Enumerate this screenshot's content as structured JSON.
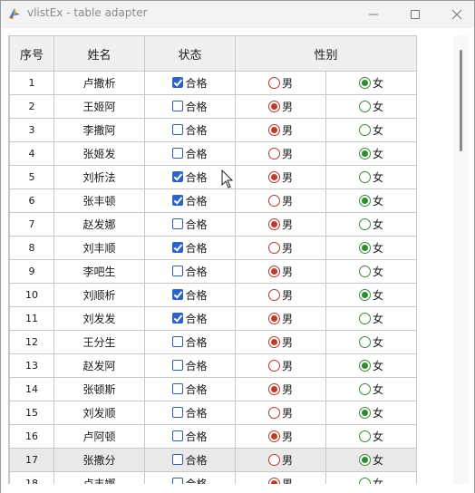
{
  "window": {
    "title": "vlistEx - table adapter"
  },
  "headers": {
    "seq": "序号",
    "name": "姓名",
    "status": "状态",
    "gender": "性别"
  },
  "labels": {
    "pass": "合格",
    "male": "男",
    "female": "女"
  },
  "rows": [
    {
      "seq": "1",
      "name": "卢撒析",
      "pass": true,
      "gender": "female"
    },
    {
      "seq": "2",
      "name": "王姬阿",
      "pass": false,
      "gender": "male"
    },
    {
      "seq": "3",
      "name": "李撒阿",
      "pass": false,
      "gender": "male"
    },
    {
      "seq": "4",
      "name": "张姬发",
      "pass": false,
      "gender": "female"
    },
    {
      "seq": "5",
      "name": "刘析法",
      "pass": true,
      "gender": "male"
    },
    {
      "seq": "6",
      "name": "张丰顿",
      "pass": true,
      "gender": "female"
    },
    {
      "seq": "7",
      "name": "赵发娜",
      "pass": false,
      "gender": "male"
    },
    {
      "seq": "8",
      "name": "刘丰顺",
      "pass": true,
      "gender": "female"
    },
    {
      "seq": "9",
      "name": "李吧生",
      "pass": false,
      "gender": "male"
    },
    {
      "seq": "10",
      "name": "刘顺析",
      "pass": true,
      "gender": "female"
    },
    {
      "seq": "11",
      "name": "刘发发",
      "pass": true,
      "gender": "male"
    },
    {
      "seq": "12",
      "name": "王分生",
      "pass": false,
      "gender": "male"
    },
    {
      "seq": "13",
      "name": "赵发阿",
      "pass": false,
      "gender": "female"
    },
    {
      "seq": "14",
      "name": "张顿斯",
      "pass": false,
      "gender": "male"
    },
    {
      "seq": "15",
      "name": "刘发顺",
      "pass": false,
      "gender": "female"
    },
    {
      "seq": "16",
      "name": "卢阿顿",
      "pass": false,
      "gender": "male"
    },
    {
      "seq": "17",
      "name": "张撒分",
      "pass": false,
      "gender": "female"
    },
    {
      "seq": "18",
      "name": "卢丰娜",
      "pass": false,
      "gender": "male"
    }
  ],
  "highlighted_row": "17",
  "icons": {
    "app": "app-logo-icon",
    "minimize": "minimize-icon",
    "maximize": "maximize-icon",
    "close": "close-icon"
  }
}
